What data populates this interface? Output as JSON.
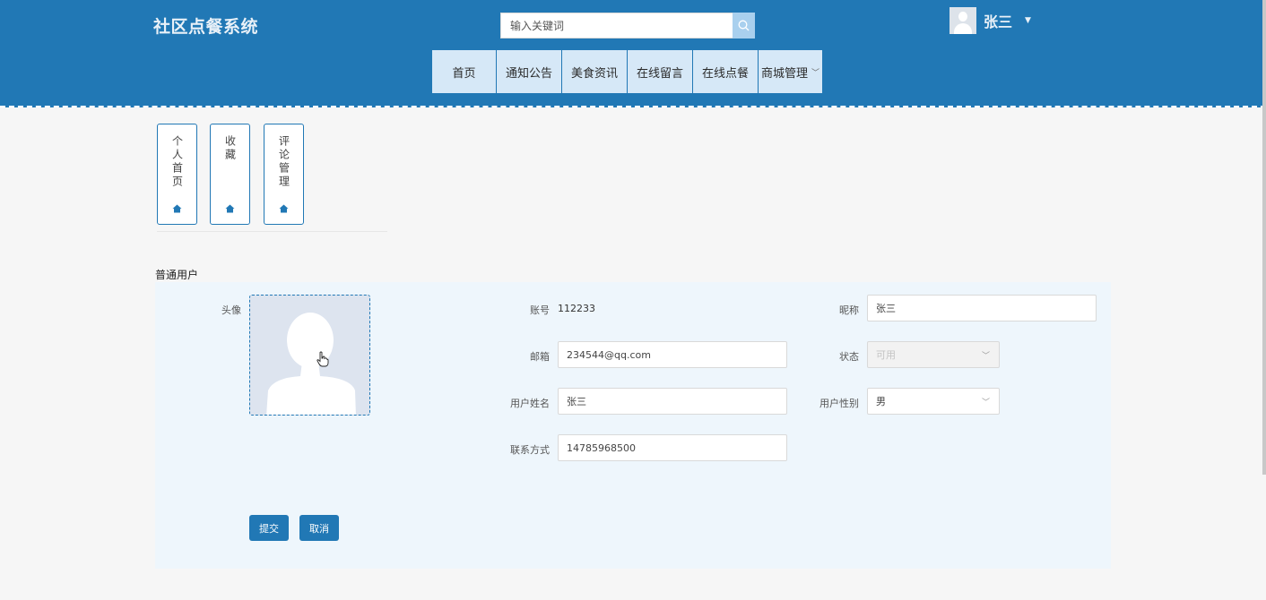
{
  "header": {
    "logo": "社区点餐系统",
    "search_placeholder": "输入关键词",
    "user_name": "张三"
  },
  "nav": [
    {
      "label": "首页"
    },
    {
      "label": "通知公告"
    },
    {
      "label": "美食资讯"
    },
    {
      "label": "在线留言"
    },
    {
      "label": "在线点餐"
    },
    {
      "label": "商城管理"
    }
  ],
  "quick_links": [
    {
      "label": "个人首页"
    },
    {
      "label": "收藏"
    },
    {
      "label": "评论管理"
    }
  ],
  "section_title": "普通用户",
  "form": {
    "avatar_label": "头像",
    "account_label": "账号",
    "account_value": "112233",
    "nickname_label": "昵称",
    "nickname_value": "张三",
    "email_label": "邮箱",
    "email_value": "234544@qq.com",
    "status_label": "状态",
    "status_value": "可用",
    "realname_label": "用户姓名",
    "realname_value": "张三",
    "gender_label": "用户性别",
    "gender_value": "男",
    "phone_label": "联系方式",
    "phone_value": "14785968500"
  },
  "buttons": {
    "submit": "提交",
    "cancel": "取消"
  },
  "colors": {
    "primary": "#2178b5",
    "nav_bg": "#d6e8f7",
    "panel_bg": "#eef6fc"
  }
}
